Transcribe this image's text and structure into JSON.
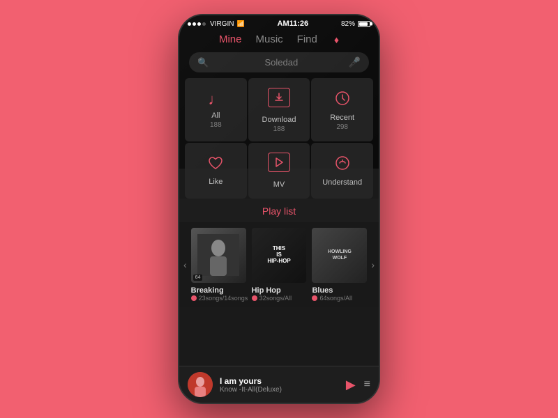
{
  "statusBar": {
    "carrier": "VIRGIN",
    "time": "AM11:26",
    "battery": "82%"
  },
  "nav": {
    "tabs": [
      "Mine",
      "Music",
      "Find"
    ],
    "activeTab": "Mine"
  },
  "search": {
    "placeholder": "Soledad"
  },
  "grid": {
    "items": [
      {
        "id": "all",
        "label": "All",
        "count": "188",
        "icon": "♩"
      },
      {
        "id": "download",
        "label": "Download",
        "count": "188",
        "icon": "↓"
      },
      {
        "id": "recent",
        "label": "Recent",
        "count": "298",
        "icon": "⏱"
      },
      {
        "id": "like",
        "label": "Like",
        "count": "",
        "icon": "♡"
      },
      {
        "id": "mv",
        "label": "MV",
        "count": "",
        "icon": "▷"
      },
      {
        "id": "understand",
        "label": "Understand",
        "count": "",
        "icon": "♪"
      }
    ]
  },
  "playlist": {
    "sectionTitle": "Play list",
    "items": [
      {
        "name": "Breaking",
        "songs": "23songs/14songs",
        "thumbType": "breaking",
        "thumbLabel": ""
      },
      {
        "name": "Hip Hop",
        "songs": "32songs/All",
        "thumbType": "hiphop",
        "thumbLabel": "THIS IS HIP-HOP"
      },
      {
        "name": "Blues",
        "songs": "64songs/All",
        "thumbType": "blues",
        "thumbLabel": "HOWLING WOLF"
      }
    ]
  },
  "nowPlaying": {
    "title": "I am yours",
    "artist": "Know -It-All(Deluxe)"
  }
}
